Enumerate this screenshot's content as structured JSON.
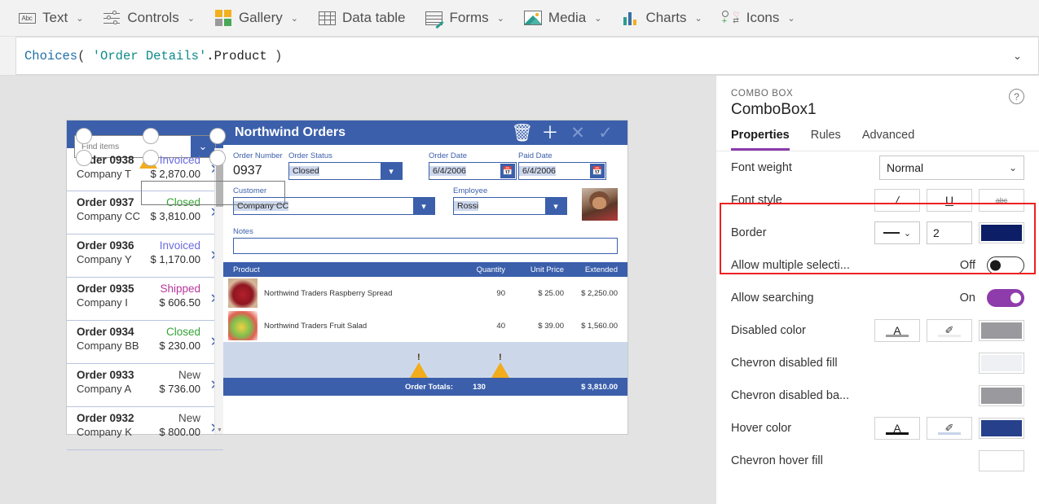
{
  "toolbar": {
    "items": [
      {
        "label": "Text",
        "icon": "text-icon",
        "chevron": "⌄"
      },
      {
        "label": "Controls",
        "icon": "controls-icon",
        "chevron": "⌄"
      },
      {
        "label": "Gallery",
        "icon": "gallery-icon",
        "chevron": "⌄"
      },
      {
        "label": "Data table",
        "icon": "data-table-icon",
        "chevron": ""
      },
      {
        "label": "Forms",
        "icon": "forms-icon",
        "chevron": "⌄"
      },
      {
        "label": "Media",
        "icon": "media-icon",
        "chevron": "⌄"
      },
      {
        "label": "Charts",
        "icon": "charts-icon",
        "chevron": "⌄"
      },
      {
        "label": "Icons",
        "icon": "icons-icon",
        "chevron": "⌄"
      }
    ],
    "text_icon_glyph": "Abc"
  },
  "formula_bar": {
    "fn": "Choices",
    "open_paren": "( ",
    "string": "'Order Details'",
    "property": ".Product",
    "close_paren": " )",
    "expand_chevron": "⌄"
  },
  "app": {
    "gallery": {
      "search_placeholder": "Find items",
      "search_chevron": "⌄",
      "rows": [
        {
          "order": "Order 0938",
          "company": "Company T",
          "status": "Invoiced",
          "amount": "$ 2,870.00",
          "status_color": "#6a6ae0",
          "warning": true
        },
        {
          "order": "Order 0937",
          "company": "Company CC",
          "status": "Closed",
          "amount": "$ 3,810.00",
          "status_color": "#36a336",
          "warning": false
        },
        {
          "order": "Order 0936",
          "company": "Company Y",
          "status": "Invoiced",
          "amount": "$ 1,170.00",
          "status_color": "#6a6ae0",
          "warning": false
        },
        {
          "order": "Order 0935",
          "company": "Company I",
          "status": "Shipped",
          "amount": "$ 606.50",
          "status_color": "#b5379b",
          "warning": false
        },
        {
          "order": "Order 0934",
          "company": "Company BB",
          "status": "Closed",
          "amount": "$ 230.00",
          "status_color": "#36a336",
          "warning": false
        },
        {
          "order": "Order 0933",
          "company": "Company A",
          "status": "New",
          "amount": "$ 736.00",
          "status_color": "#4a4a4a",
          "warning": false
        },
        {
          "order": "Order 0932",
          "company": "Company K",
          "status": "New",
          "amount": "$ 800.00",
          "status_color": "#4a4a4a",
          "warning": false
        }
      ],
      "chevron": "›"
    },
    "detail": {
      "title": "Northwind Orders",
      "actions": [
        {
          "name": "delete-order-button",
          "glyph": "🗑",
          "dim": false
        },
        {
          "name": "new-order-button",
          "glyph": "＋",
          "dim": false
        },
        {
          "name": "cancel-button",
          "glyph": "✕",
          "dim": true
        },
        {
          "name": "save-button",
          "glyph": "✓",
          "dim": true
        }
      ],
      "fields": {
        "order_number_label": "Order Number",
        "order_number_value": "0937",
        "order_status_label": "Order Status",
        "order_status_value": "Closed",
        "order_date_label": "Order Date",
        "order_date_value": "6/4/2006",
        "paid_date_label": "Paid Date",
        "paid_date_value": "6/4/2006",
        "customer_label": "Customer",
        "customer_value": "Company CC",
        "employee_label": "Employee",
        "employee_value": "Rossi",
        "notes_label": "Notes",
        "notes_value": ""
      },
      "line_items": {
        "headers": [
          "Product",
          "Quantity",
          "Unit Price",
          "Extended"
        ],
        "rows": [
          {
            "product": "Northwind Traders Raspberry Spread",
            "quantity": "90",
            "unit_price": "$ 25.00",
            "extended": "$ 2,250.00",
            "thumb": "raspberry-spread-thumbnail"
          },
          {
            "product": "Northwind Traders Fruit Salad",
            "quantity": "40",
            "unit_price": "$ 39.00",
            "extended": "$ 1,560.00",
            "thumb": "fruit-salad-thumbnail"
          }
        ],
        "totals_label": "Order Totals:",
        "totals_quantity": "130",
        "totals_extended": "$ 3,810.00"
      }
    }
  },
  "panel": {
    "kind": "COMBO BOX",
    "name": "ComboBox1",
    "help_glyph": "?",
    "tabs": [
      {
        "label": "Properties",
        "active": true
      },
      {
        "label": "Rules",
        "active": false
      },
      {
        "label": "Advanced",
        "active": false
      }
    ],
    "rows": {
      "font_weight_label": "Font weight",
      "font_weight_value": "Normal",
      "font_style_label": "Font style",
      "font_style_italic": "/",
      "font_style_underline": "U",
      "font_style_strike": "abc",
      "border_label": "Border",
      "border_style_glyph": "—",
      "border_width": "2",
      "border_color": "#0c1f66",
      "allow_multiple_label": "Allow multiple selecti...",
      "allow_multiple_state": "Off",
      "allow_searching_label": "Allow searching",
      "allow_searching_state": "On",
      "disabled_color_label": "Disabled color",
      "disabled_color": "#9a9a9e",
      "chevron_disabled_fill_label": "Chevron disabled fill",
      "chevron_disabled_fill": "#eef0f4",
      "chevron_disabled_bg_label": "Chevron disabled ba...",
      "chevron_disabled_bg": "#9a9a9e",
      "hover_color_label": "Hover color",
      "hover_color": "#26408b",
      "chevron_hover_fill_label": "Chevron hover fill",
      "chevron_hover_fill": "#ffffff",
      "text_glyph": "A",
      "fill_glyph": "✐",
      "select_chevron": "⌄"
    },
    "accent": "#8e3bab",
    "highlight_border": "#ee2020"
  }
}
